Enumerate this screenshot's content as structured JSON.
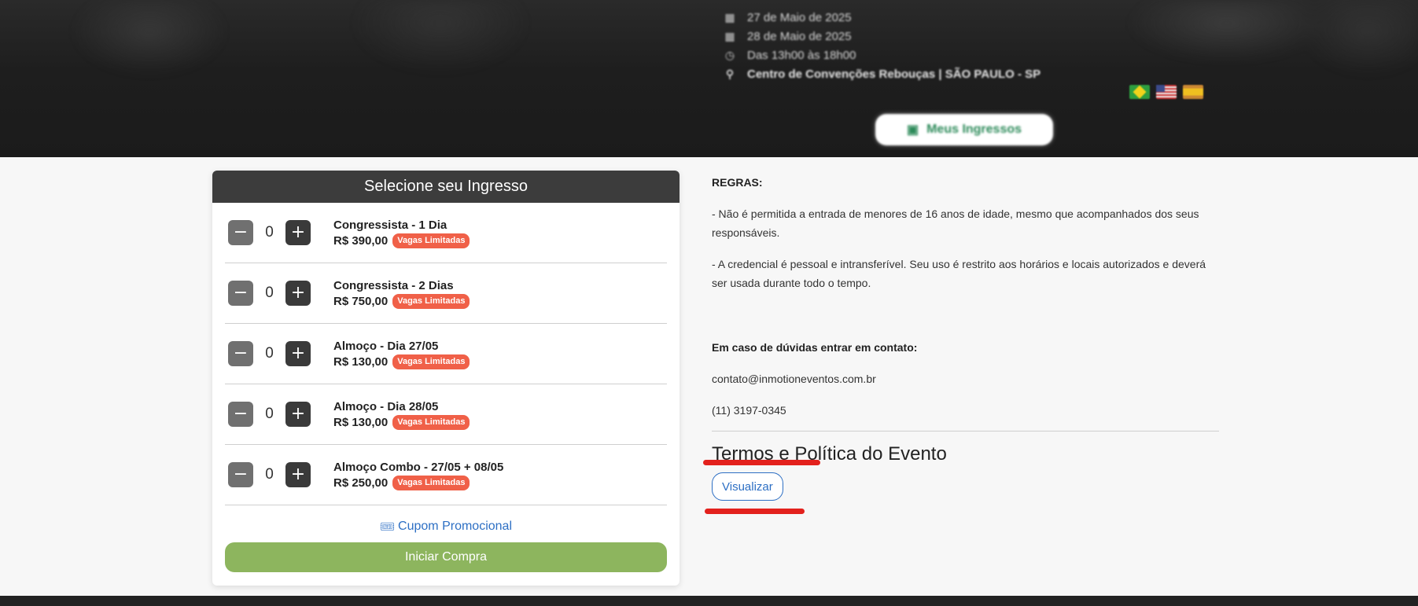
{
  "banner": {
    "dates": [
      {
        "icon": "calendar-icon",
        "text": "27 de Maio de 2025"
      },
      {
        "icon": "calendar-icon",
        "text": "28 de Maio de 2025"
      },
      {
        "icon": "clock-icon",
        "text": "Das 13h00 às 18h00"
      }
    ],
    "location": "Centro de Convenções Rebouças | SÃO PAULO - SP",
    "languages": [
      "pt-BR",
      "en-US",
      "es"
    ],
    "my_tickets_label": "Meus Ingressos"
  },
  "tickets": {
    "header": "Selecione seu Ingresso",
    "minus_symbol": "−",
    "plus_symbol": "+",
    "items": [
      {
        "name": "Congressista - 1 Dia",
        "price": "R$ 390,00",
        "quantity": "0",
        "badge": "Vagas Limitadas"
      },
      {
        "name": "Congressista - 2 Dias",
        "price": "R$ 750,00",
        "quantity": "0",
        "badge": "Vagas Limitadas"
      },
      {
        "name": "Almoço - Dia 27/05",
        "price": "R$ 130,00",
        "quantity": "0",
        "badge": "Vagas Limitadas"
      },
      {
        "name": "Almoço - Dia 28/05",
        "price": "R$ 130,00",
        "quantity": "0",
        "badge": "Vagas Limitadas"
      },
      {
        "name": "Almoço Combo - 27/05 + 08/05",
        "price": "R$ 250,00",
        "quantity": "0",
        "badge": "Vagas Limitadas"
      }
    ],
    "coupon_label": "Cupom Promocional",
    "buy_label": "Iniciar Compra"
  },
  "rules": {
    "title": "REGRAS:",
    "items": [
      " - Não é permitida a entrada de menores de 16 anos de idade, mesmo que acompanhados dos seus responsáveis.",
      " - A credencial é pessoal e intransferível. Seu uso é restrito aos horários e locais autorizados e deverá ser usada durante todo o tempo."
    ],
    "contact_title": "Em caso de dúvidas entrar em contato:",
    "contact_email": "contato@inmotioneventos.com.br",
    "contact_phone": "(11) 3197-0345"
  },
  "terms": {
    "title": "Termos e Política do Evento",
    "view_label": "Visualizar"
  },
  "colors": {
    "accent_green": "#8db55e",
    "badge_red": "#f06048",
    "link_blue": "#2d6fc4",
    "annotation_red": "#e3211d"
  }
}
